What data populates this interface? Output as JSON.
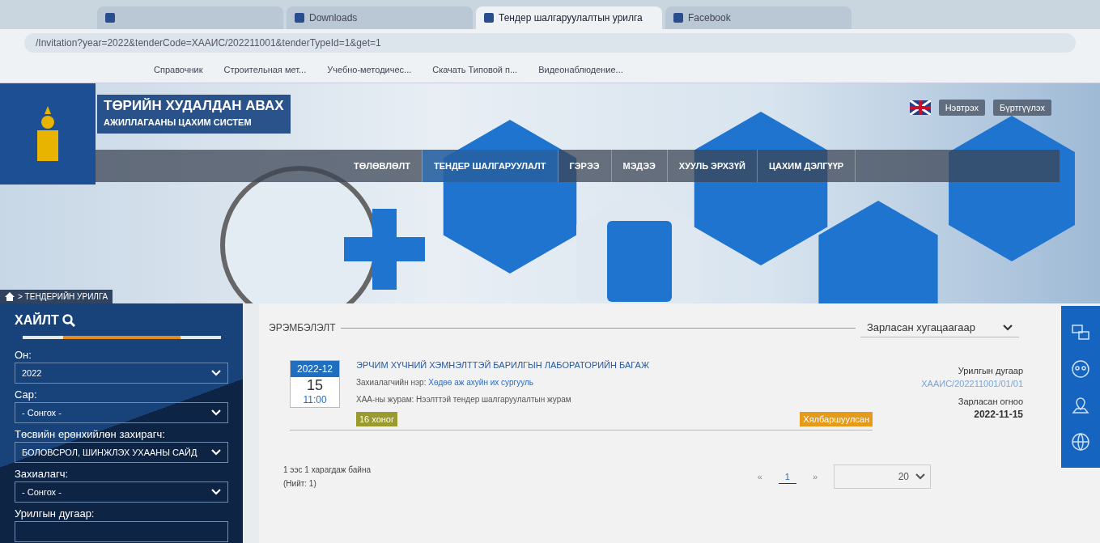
{
  "browser": {
    "tabs": [
      {
        "selected": false
      },
      {
        "title": "Downloads",
        "selected": false
      },
      {
        "title": "Тендер шалгаруулалтын урилга",
        "selected": true
      },
      {
        "title": "Facebook",
        "selected": false
      }
    ],
    "address": "/Invitation?year=2022&tenderCode=ХААИС/202211001&tenderTypeId=1&get=1",
    "bookmarks": [
      "Справочник",
      "Строительная мет...",
      "Учебно-методичес...",
      "Скачать Типовой п...",
      "Видеонаблюдение..."
    ]
  },
  "header": {
    "title": "ТӨРИЙН ХУДАЛДАН АВАХ",
    "subtitle": "АЖИЛЛАГААНЫ ЦАХИМ СИСТЕМ",
    "login": "Нэвтрэх",
    "register": "Бүртгүүлэх",
    "nav": [
      {
        "label": "ТӨЛӨВЛӨЛТ",
        "selected": false
      },
      {
        "label": "ТЕНДЕР ШАЛГАРУУЛАЛТ",
        "selected": true
      },
      {
        "label": "ГЭРЭЭ",
        "selected": false
      },
      {
        "label": "МЭДЭЭ",
        "selected": false
      },
      {
        "label": "ХУУЛЬ ЭРХЗҮЙ",
        "selected": false
      },
      {
        "label": "ЦАХИМ ДЭЛГҮҮР",
        "selected": false
      }
    ],
    "breadcrumb": "> ТЕНДЕРИЙН УРИЛГА"
  },
  "search": {
    "title": "ХАЙЛТ",
    "fields": [
      {
        "label": "Он:",
        "value": "2022"
      },
      {
        "label": "Сар:",
        "value": "- Сонгох -"
      },
      {
        "label": "Төсвийн ерөнхийлөн захирагч:",
        "value": "БОЛОВСРОЛ, ШИНЖЛЭХ УХААНЫ САЙД"
      },
      {
        "label": "Захиалагч:",
        "value": "- Сонгох -"
      },
      {
        "label": "Урилгын дугаар:"
      }
    ]
  },
  "sort": {
    "label": "ЭРЭМБЭЛЭЛТ",
    "value": "Зарласан хугацаагаар"
  },
  "tenders": [
    {
      "month": "2022-12",
      "day": "15",
      "time": "11:00",
      "title": "ЭРЧИМ ХҮЧНИЙ ХЭМНЭЛТТЭЙ БАРИЛГЫН ЛАБОРАТОРИЙН БАГАЖ",
      "customer_label": "Захиалагчийн нэр:",
      "customer": "Хөдөө аж ахуйн их сургууль",
      "procedure_label": "ХАА-ны журам:",
      "procedure": "Нээлттэй тендер шалгаруулалтын журам",
      "days_left": "16 хоног",
      "type": "Хялбаршуулсан",
      "number_label": "Урилгын дугаар",
      "number": "ХААИС/202211001/01/01",
      "date_label": "Зарласан огноо",
      "date": "2022-11-15"
    }
  ],
  "footer": {
    "summary": "1 ээс 1 харагдаж байна",
    "total": "(Нийт: 1)",
    "prev": "«",
    "pages": [
      {
        "label": "1",
        "selected": true
      }
    ],
    "next": "»",
    "page_size": "20"
  }
}
